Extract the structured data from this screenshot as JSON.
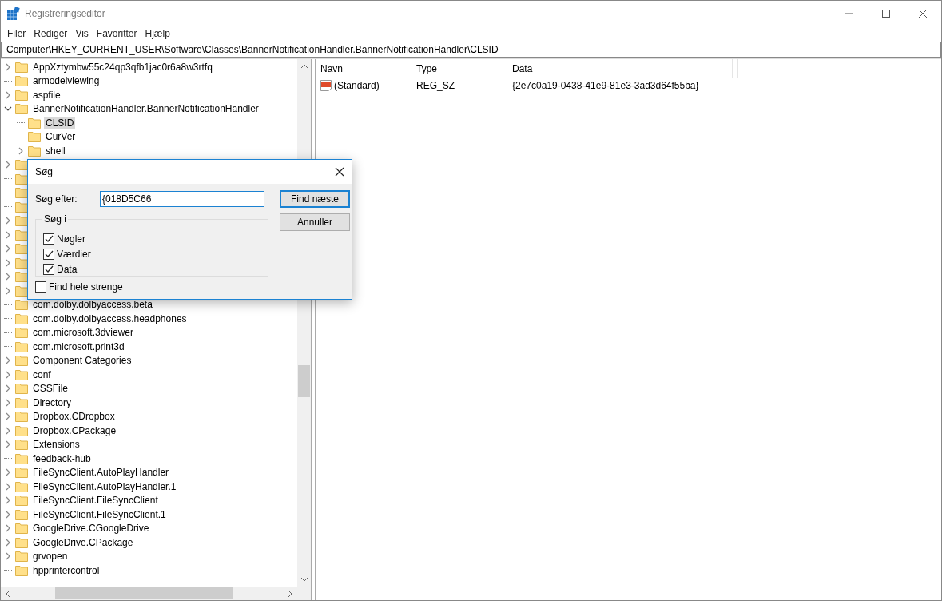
{
  "window": {
    "title": "Registreringseditor"
  },
  "menu": [
    "Filer",
    "Rediger",
    "Vis",
    "Favoritter",
    "Hjælp"
  ],
  "address": "Computer\\HKEY_CURRENT_USER\\Software\\Classes\\BannerNotificationHandler.BannerNotificationHandler\\CLSID",
  "tree": {
    "items": [
      {
        "label": "AppXztymbw55c24qp3qfb1jac0r6a8w3rtfq",
        "has_children": true,
        "expanded": false,
        "selected": false
      },
      {
        "label": "armodelviewing",
        "has_children": false,
        "selected": false
      },
      {
        "label": "aspfile",
        "has_children": true,
        "expanded": false,
        "selected": false
      },
      {
        "label": "BannerNotificationHandler.BannerNotificationHandler",
        "has_children": true,
        "expanded": true,
        "selected": false,
        "children": [
          {
            "label": "CLSID",
            "has_children": false,
            "selected": true
          },
          {
            "label": "CurVer",
            "has_children": false,
            "selected": false
          },
          {
            "label": "shell",
            "has_children": true,
            "expanded": false,
            "selected": false
          }
        ]
      },
      {
        "has_children": true,
        "expanded": false
      },
      {
        "has_children": false
      },
      {
        "has_children": false
      },
      {
        "has_children": false
      },
      {
        "has_children": true,
        "expanded": false
      },
      {
        "has_children": true,
        "expanded": false
      },
      {
        "has_children": true,
        "expanded": false
      },
      {
        "has_children": true,
        "expanded": false
      },
      {
        "has_children": true,
        "expanded": false
      },
      {
        "has_children": true,
        "expanded": false
      },
      {
        "label": "com.dolby.dolbyaccess.beta",
        "has_children": false,
        "selected": false
      },
      {
        "label": "com.dolby.dolbyaccess.headphones",
        "has_children": false,
        "selected": false
      },
      {
        "label": "com.microsoft.3dviewer",
        "has_children": false,
        "selected": false
      },
      {
        "label": "com.microsoft.print3d",
        "has_children": false,
        "selected": false
      },
      {
        "label": "Component Categories",
        "has_children": true,
        "expanded": false,
        "selected": false
      },
      {
        "label": "conf",
        "has_children": true,
        "expanded": false,
        "selected": false
      },
      {
        "label": "CSSFile",
        "has_children": true,
        "expanded": false,
        "selected": false
      },
      {
        "label": "Directory",
        "has_children": true,
        "expanded": false,
        "selected": false
      },
      {
        "label": "Dropbox.CDropbox",
        "has_children": true,
        "expanded": false,
        "selected": false
      },
      {
        "label": "Dropbox.CPackage",
        "has_children": true,
        "expanded": false,
        "selected": false
      },
      {
        "label": "Extensions",
        "has_children": true,
        "expanded": false,
        "selected": false
      },
      {
        "label": "feedback-hub",
        "has_children": false,
        "selected": false
      },
      {
        "label": "FileSyncClient.AutoPlayHandler",
        "has_children": true,
        "expanded": false,
        "selected": false
      },
      {
        "label": "FileSyncClient.AutoPlayHandler.1",
        "has_children": true,
        "expanded": false,
        "selected": false
      },
      {
        "label": "FileSyncClient.FileSyncClient",
        "has_children": true,
        "expanded": false,
        "selected": false
      },
      {
        "label": "FileSyncClient.FileSyncClient.1",
        "has_children": true,
        "expanded": false,
        "selected": false
      },
      {
        "label": "GoogleDrive.CGoogleDrive",
        "has_children": true,
        "expanded": false,
        "selected": false
      },
      {
        "label": "GoogleDrive.CPackage",
        "has_children": true,
        "expanded": false,
        "selected": false
      },
      {
        "label": "grvopen",
        "has_children": true,
        "expanded": false,
        "selected": false
      },
      {
        "label": "hpprintercontrol",
        "has_children": false,
        "selected": false
      }
    ]
  },
  "values": {
    "columns": [
      "Navn",
      "Type",
      "Data"
    ],
    "rows": [
      {
        "name": "(Standard)",
        "type": "REG_SZ",
        "data": "{2e7c0a19-0438-41e9-81e3-3ad3d64f55ba}"
      }
    ]
  },
  "dialog": {
    "title": "Søg",
    "search_label": "Søg efter:",
    "search_value": "{018D5C66",
    "group_title": "Søg i",
    "options": [
      {
        "label": "Nøgler",
        "checked": true
      },
      {
        "label": "Værdier",
        "checked": true
      },
      {
        "label": "Data",
        "checked": true
      }
    ],
    "whole_strings": {
      "label": "Find hele strenge",
      "checked": false
    },
    "buttons": [
      {
        "label": "Find næste",
        "default": true
      },
      {
        "label": "Annuller",
        "default": false
      }
    ]
  }
}
